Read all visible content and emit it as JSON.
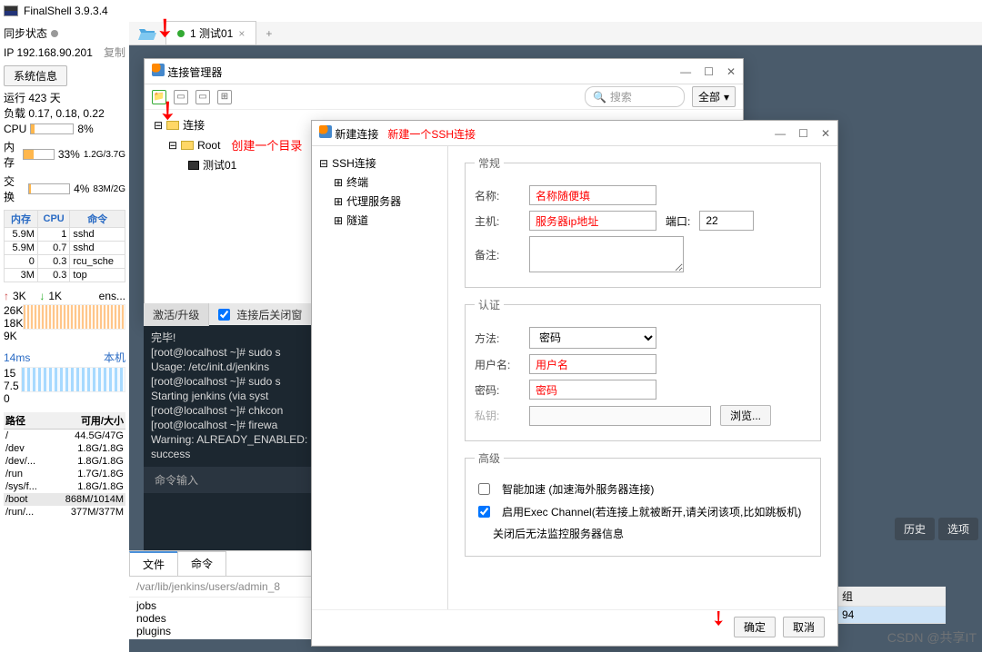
{
  "app": {
    "title": "FinalShell 3.9.3.4"
  },
  "left": {
    "sync": "同步状态",
    "ip": "IP 192.168.90.201",
    "copy": "复制",
    "sysinfo": "系统信息",
    "uptime": "运行 423 天",
    "load": "负载 0.17, 0.18, 0.22",
    "cpu_label": "CPU",
    "cpu_pct": "8%",
    "mem_label": "内存",
    "mem_pct": "33%",
    "mem_val": "1.2G/3.7G",
    "swap_label": "交换",
    "swap_pct": "4%",
    "swap_val": "83M/2G",
    "proc_headers": [
      "内存",
      "CPU",
      "命令"
    ],
    "procs": [
      [
        "5.9M",
        "1",
        "sshd"
      ],
      [
        "5.9M",
        "0.7",
        "sshd"
      ],
      [
        "0",
        "0.3",
        "rcu_sche"
      ],
      [
        "3M",
        "0.3",
        "top"
      ]
    ],
    "net_up": "3K",
    "net_down": "1K",
    "net_if": "ens...",
    "lat": "14ms",
    "lat_r": "本机",
    "scale1": [
      "26K",
      "18K",
      "9K"
    ],
    "scale2": [
      "15",
      "7.5",
      "0"
    ],
    "disk_headers": [
      "路径",
      "可用/大小"
    ],
    "disks": [
      [
        "/",
        "44.5G/47G"
      ],
      [
        "/dev",
        "1.8G/1.8G"
      ],
      [
        "/dev/...",
        "1.8G/1.8G"
      ],
      [
        "/run",
        "1.7G/1.8G"
      ],
      [
        "/sys/f...",
        "1.8G/1.8G"
      ],
      [
        "/boot",
        "868M/1014M"
      ],
      [
        "/run/...",
        "377M/377M"
      ]
    ]
  },
  "tabs": {
    "t1": "1 测试01"
  },
  "conn_mgr": {
    "title": "连接管理器",
    "search_ph": "搜索",
    "all": "全部",
    "tree_root": "连接",
    "tree_folder": "Root",
    "tree_item": "测试01",
    "anno": "创建一个目录"
  },
  "term": {
    "tab1": "激活/升级",
    "check": "连接后关闭窗",
    "lines": "完毕!\n[root@localhost ~]# sudo s\nUsage: /etc/init.d/jenkins\n[root@localhost ~]# sudo s\nStarting jenkins (via syst\n[root@localhost ~]# chkcon\n[root@localhost ~]# firewa\nWarning: ALREADY_ENABLED:\nsuccess",
    "input_ph": "命令输入"
  },
  "files": {
    "tab1": "文件",
    "tab2": "命令",
    "breadcrumb": "/var/lib/jenkins/users/admin_8",
    "items": [
      "jobs",
      "nodes",
      "plugins"
    ]
  },
  "new_conn": {
    "title": "新建连接",
    "anno": "新建一个SSH连接",
    "tree_root": "SSH连接",
    "tree_items": [
      "终端",
      "代理服务器",
      "隧道"
    ],
    "group_general": "常规",
    "lbl_name": "名称:",
    "val_name": "名称随便填",
    "lbl_host": "主机:",
    "val_host": "服务器ip地址",
    "lbl_port": "端口:",
    "val_port": "22",
    "lbl_remark": "备注:",
    "group_auth": "认证",
    "lbl_method": "方法:",
    "val_method": "密码",
    "lbl_user": "用户名:",
    "val_user": "用户名",
    "lbl_pass": "密码:",
    "val_pass": "密码",
    "lbl_key": "私钥:",
    "btn_browse": "浏览...",
    "group_adv": "高级",
    "adv1": "智能加速 (加速海外服务器连接)",
    "adv2": "启用Exec Channel(若连接上就被断开,请关闭该项,比如跳板机)",
    "adv3": "关闭后无法监控服务器信息",
    "btn_ok": "确定",
    "btn_cancel": "取消"
  },
  "right": {
    "history": "历史",
    "options": "选项",
    "group": "组",
    "val94": "94"
  },
  "watermark": "CSDN @共享IT"
}
